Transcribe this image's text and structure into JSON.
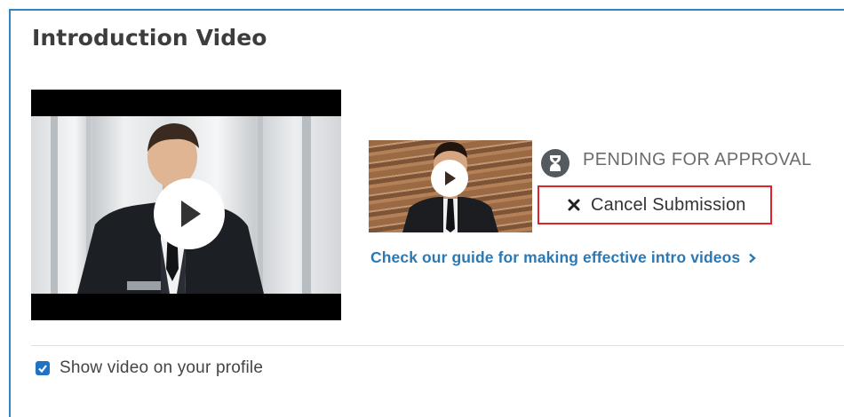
{
  "section": {
    "title": "Introduction Video"
  },
  "status": {
    "text": "PENDING FOR APPROVAL",
    "icon": "hourglass-icon"
  },
  "cancel": {
    "label": "Cancel Submission",
    "icon": "close-icon"
  },
  "guide_link": {
    "label": "Check our guide for making effective intro videos",
    "icon": "chevron-right-icon"
  },
  "profile_toggle": {
    "label": "Show video on your profile",
    "checked": true
  },
  "colors": {
    "accent_border": "#2d84c8",
    "cancel_border": "#e0222a",
    "link": "#2b79b4",
    "checkbox": "#1f72c4"
  }
}
